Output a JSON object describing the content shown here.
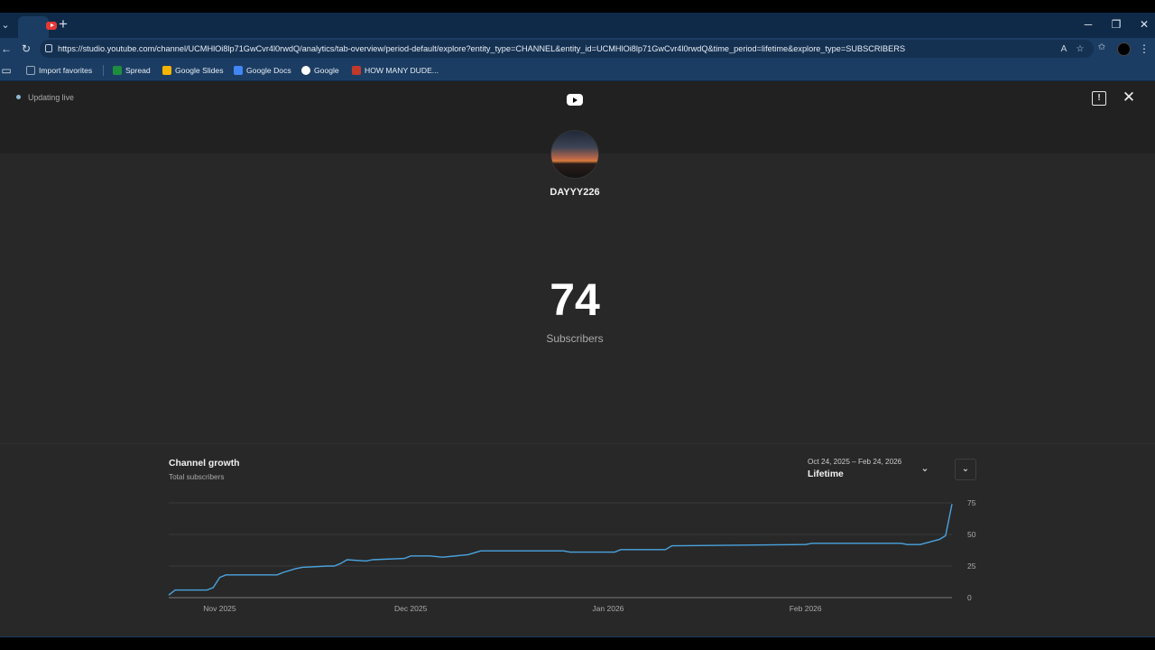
{
  "browser": {
    "url": "https://studio.youtube.com/channel/UCMHlOi8lp71GwCvr4l0rwdQ/analytics/tab-overview/period-default/explore?entity_type=CHANNEL&entity_id=UCMHlOi8lp71GwCvr4l0rwdQ&time_period=lifetime&explore_type=SUBSCRIBERS",
    "bookmarks": [
      {
        "label": "Import favorites",
        "icon": "import-icon",
        "color": "#9aa7b5"
      },
      {
        "label": "Spread",
        "icon": "sheets-icon",
        "color": "#1e8e3e"
      },
      {
        "label": "Google Slides",
        "icon": "slides-icon",
        "color": "#f4b400"
      },
      {
        "label": "Google Docs",
        "icon": "docs-icon",
        "color": "#4285f4"
      },
      {
        "label": "Google",
        "icon": "google-icon",
        "color": "#ffffff"
      },
      {
        "label": "HOW MANY DUDE...",
        "icon": "custom-icon",
        "color": "#c0392b"
      }
    ]
  },
  "studio": {
    "status_text": "Updating live",
    "channel_name": "DAYYY226",
    "subscriber_count": "74",
    "subscriber_label": "Subscribers"
  },
  "growth": {
    "title": "Channel growth",
    "subtitle": "Total subscribers",
    "date_range": "Oct 24, 2025 – Feb 24, 2026",
    "period": "Lifetime"
  },
  "chart_data": {
    "type": "line",
    "title": "Channel growth",
    "ylabel": "Total subscribers",
    "ylim": [
      0,
      75
    ],
    "yticks": [
      0,
      25,
      50,
      75
    ],
    "x_tick_labels": [
      "Nov 2025",
      "Dec 2025",
      "Jan 2026",
      "Feb 2026"
    ],
    "x_tick_dates": [
      "2025-11-01",
      "2025-12-01",
      "2026-01-01",
      "2026-02-01"
    ],
    "x_range": [
      "2025-10-24",
      "2026-02-24"
    ],
    "grid": true,
    "line_color": "#4aa3df",
    "series": [
      {
        "x": [
          "2025-10-24",
          "2025-10-25",
          "2025-10-30",
          "2025-10-31",
          "2025-11-01",
          "2025-11-02",
          "2025-11-10",
          "2025-11-11",
          "2025-11-13",
          "2025-11-14",
          "2025-11-18",
          "2025-11-19",
          "2025-11-20",
          "2025-11-21",
          "2025-11-24",
          "2025-11-25",
          "2025-11-30",
          "2025-12-01",
          "2025-12-04",
          "2025-12-06",
          "2025-12-10",
          "2025-12-12",
          "2025-12-25",
          "2025-12-26",
          "2026-01-02",
          "2026-01-03",
          "2026-01-10",
          "2026-01-11",
          "2026-02-01",
          "2026-02-02",
          "2026-02-16",
          "2026-02-17",
          "2026-02-18",
          "2026-02-19",
          "2026-02-22",
          "2026-02-23",
          "2026-02-24"
        ],
        "y": [
          2,
          6,
          6,
          8,
          16,
          18,
          18,
          20,
          23,
          24,
          25,
          25,
          27,
          30,
          29,
          30,
          31,
          33,
          33,
          32,
          34,
          37,
          37,
          36,
          36,
          38,
          38,
          41,
          42,
          43,
          43,
          42,
          42,
          42,
          46,
          49,
          74
        ]
      }
    ]
  }
}
